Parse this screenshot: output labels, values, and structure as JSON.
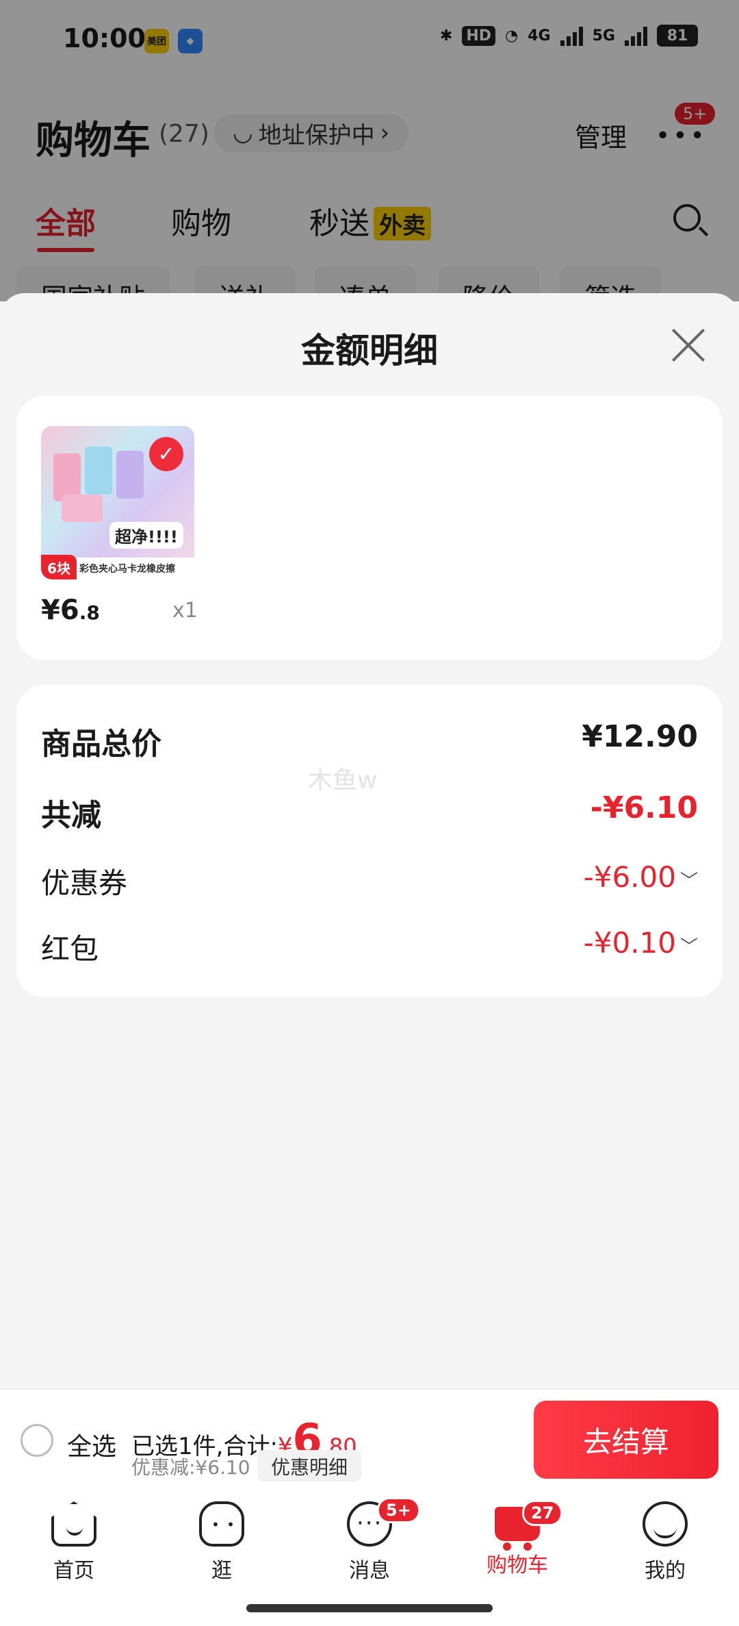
{
  "status_bar": {
    "time": "10:00",
    "app_icons": [
      "美团",
      "browser-icon"
    ],
    "hd_label": "HD",
    "network_labels": [
      "4G",
      "5G"
    ],
    "battery": "81"
  },
  "header": {
    "title": "购物车",
    "count": "(27)",
    "address_protection": "地址保护中",
    "manage": "管理",
    "more_badge": "5+"
  },
  "tabs": [
    {
      "label": "全部",
      "active": true
    },
    {
      "label": "购物",
      "active": false
    },
    {
      "label": "秒送",
      "tag": "外卖",
      "active": false
    }
  ],
  "filter_chips": [
    "国家补贴",
    "送礼",
    "凑单",
    "降价",
    "筛选"
  ],
  "sheet": {
    "title": "金额明细",
    "product": {
      "image_caption": "彩色夹心马卡龙橡皮擦",
      "image_bubble": "超净!!!!",
      "image_count": "6块",
      "price_symbol": "¥",
      "price_int": "6",
      "price_dec": ".8",
      "qty": "x1"
    },
    "summary": {
      "total_label": "商品总价",
      "total_value": "¥12.90",
      "reduce_label": "共减",
      "reduce_value": "-¥6.10",
      "coupon_label": "优惠券",
      "coupon_value": "-¥6.00",
      "redpacket_label": "红包",
      "redpacket_value": "-¥0.10",
      "watermark": "木鱼w"
    }
  },
  "checkout_bar": {
    "select_all": "全选",
    "selected_text": "已选1件,合计:",
    "total_yen": "¥",
    "total_int": "6",
    "total_dec": ".80",
    "discount_text": "优惠减:¥6.10",
    "detail_button": "优惠明细",
    "checkout_button": "去结算"
  },
  "bottom_nav": [
    {
      "label": "首页",
      "icon": "home-icon"
    },
    {
      "label": "逛",
      "icon": "guang-icon"
    },
    {
      "label": "消息",
      "icon": "message-icon",
      "badge": "5+"
    },
    {
      "label": "购物车",
      "icon": "cart-icon",
      "badge": "27",
      "active": true
    },
    {
      "label": "我的",
      "icon": "profile-icon"
    }
  ],
  "colors": {
    "accent_red": "#e8232e",
    "sheet_background": "#f4f4f4",
    "card_background": "#ffffff"
  }
}
